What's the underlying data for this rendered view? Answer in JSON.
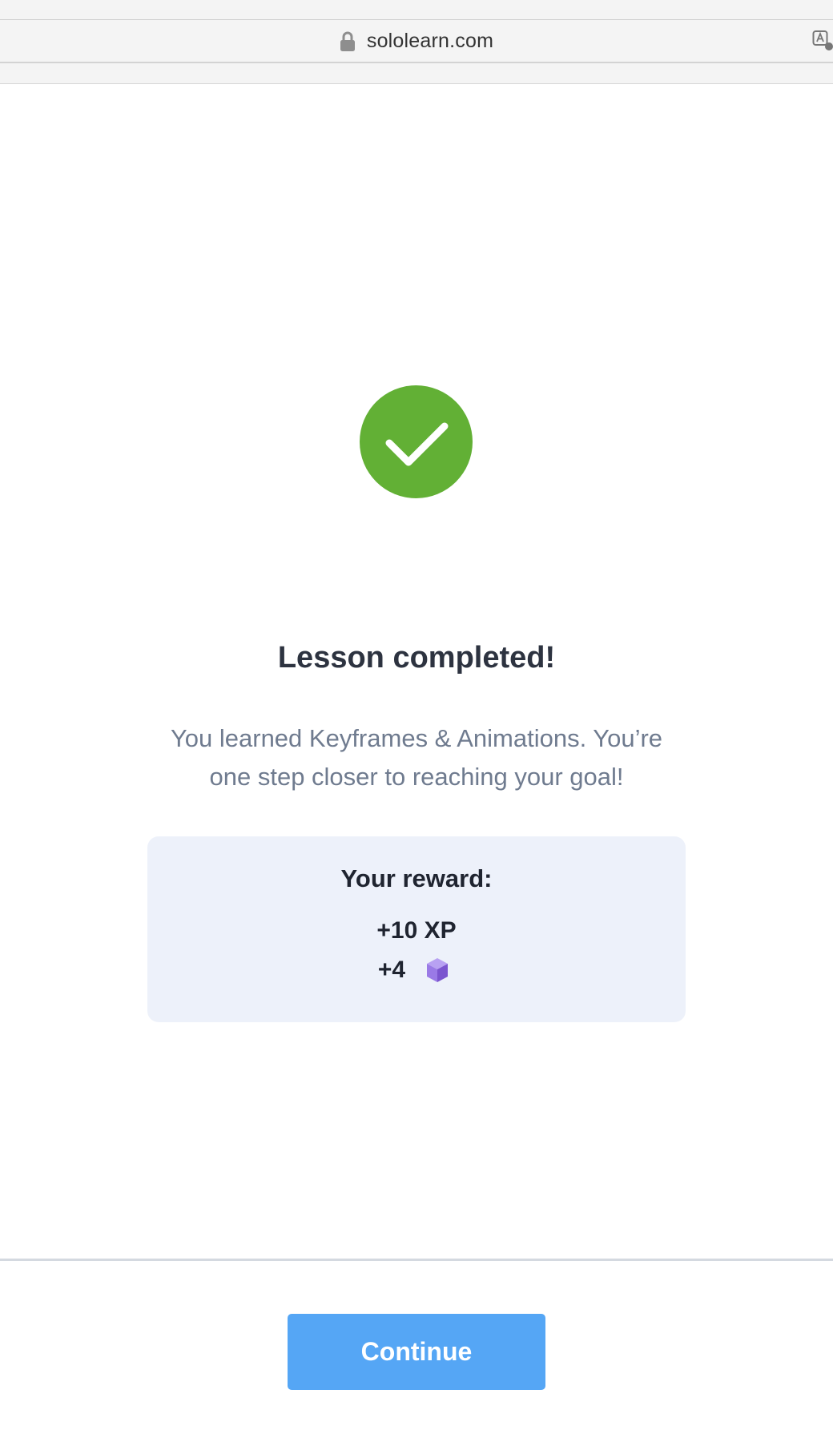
{
  "browser": {
    "url": "sololearn.com",
    "lock_icon": "lock-icon",
    "translate_icon": "translate-icon"
  },
  "completion": {
    "status_icon": "checkmark-icon",
    "title": "Lesson completed!",
    "message_line1": "You learned Keyframes & Animations. You’re",
    "message_line2": "one step closer to reaching your goal!"
  },
  "reward": {
    "heading": "Your reward:",
    "xp": "+10 XP",
    "gems": "+4",
    "gem_icon": "cube-gem-icon"
  },
  "footer": {
    "continue_label": "Continue"
  },
  "colors": {
    "success_green": "#62b035",
    "button_blue": "#55a6f5",
    "card_background": "#edf1fa",
    "gem_purple": "#8a62d6"
  }
}
